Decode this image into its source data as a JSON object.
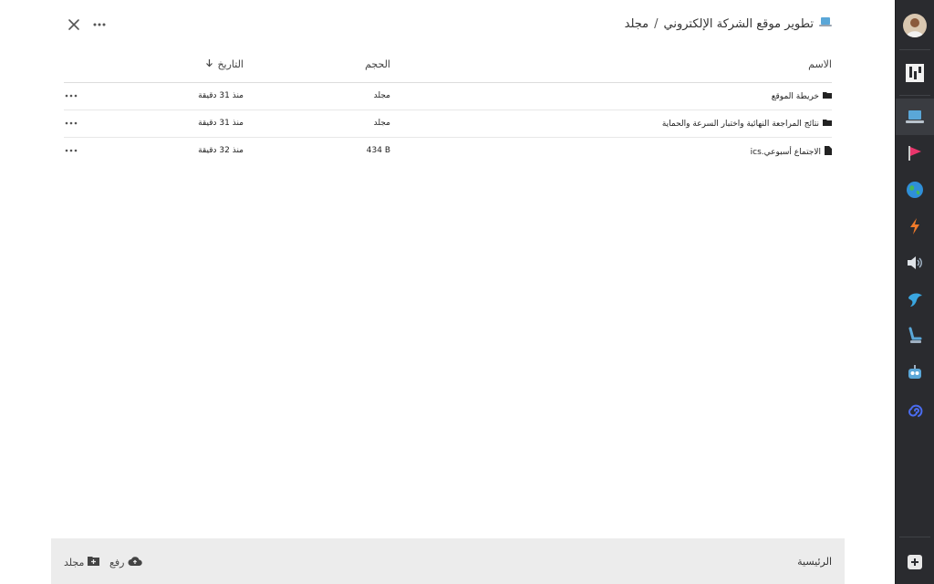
{
  "header": {
    "folder_title": "تطوير موقع الشركة الإلكتروني",
    "separator": "/",
    "current": "مجلد"
  },
  "table": {
    "columns": {
      "name": "الاسم",
      "size": "الحجم",
      "date": "التاريخ"
    },
    "rows": [
      {
        "name": "خريطة الموقع",
        "type": "folder",
        "size": "مجلد",
        "date": "منذ 31 دقيقة"
      },
      {
        "name": "نتائج المراجعة النهائية واختبار السرعة والحماية",
        "type": "folder",
        "size": "مجلد",
        "date": "منذ 31 دقيقة"
      },
      {
        "name": "الاجتماع أسبوعي.ics",
        "type": "file",
        "size": "434 B",
        "date": "منذ 32 دقيقة"
      }
    ]
  },
  "footer": {
    "title": "الرئيسية",
    "upload_label": "رفع",
    "new_folder_label": "مجلد"
  },
  "colors": {
    "sidebar_bg": "#2a2b2f",
    "footer_bg": "#ececec",
    "accent_flag": "#e8356b",
    "accent_globe": "#2f8fd8",
    "accent_bolt": "#f07a2a",
    "accent_spiral": "#4a6cf0"
  }
}
